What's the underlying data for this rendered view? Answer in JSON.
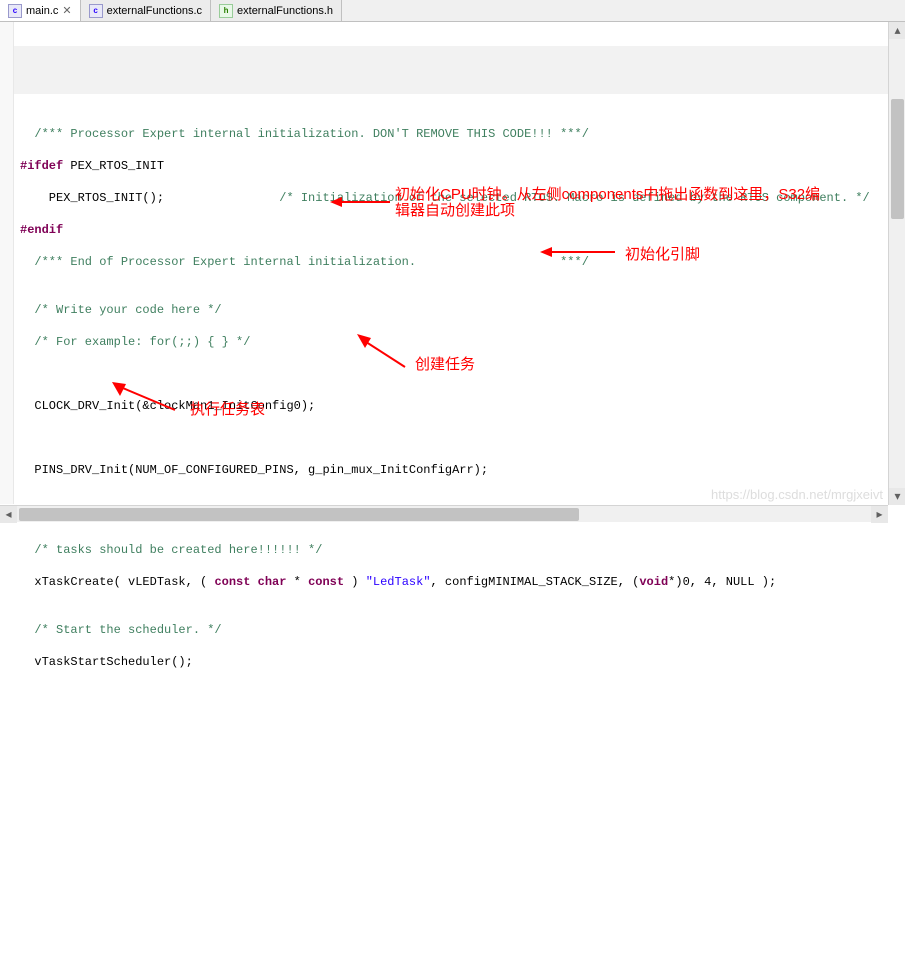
{
  "tabs": [
    {
      "icon": ".c",
      "label": "main.c",
      "active": true,
      "closable": true
    },
    {
      "icon": ".c",
      "label": "externalFunctions.c",
      "active": false,
      "closable": false
    },
    {
      "icon": ".h",
      "label": "externalFunctions.h",
      "active": false,
      "closable": false
    }
  ],
  "code": {
    "l1": "  /*** Processor Expert internal initialization. DON'T REMOVE THIS CODE!!! ***/",
    "l2a": "#ifdef",
    "l2b": " PEX_RTOS_INIT",
    "l3a": "    PEX_RTOS_INIT();                ",
    "l3b": "/* Initialization of the selected RTOS. Macro is defined by the RTOS component. */",
    "l4": "#endif",
    "l5": "  /*** End of Processor Expert internal initialization.                    ***/",
    "l6": "",
    "l7": "  /* Write your code here */",
    "l8": "  /* For example: for(;;) { } */",
    "l9": "",
    "l10": "",
    "l11": "  CLOCK_DRV_Init(&clockMan1_InitConfig0);",
    "l12": "",
    "l13": "",
    "l14": "  PINS_DRV_Init(NUM_OF_CONFIGURED_PINS, g_pin_mux_InitConfigArr);",
    "l15": "",
    "l16": "",
    "l17": "",
    "l18": "  /* tasks should be created here!!!!!! */",
    "l19a": "  xTaskCreate( vLEDTask, ( ",
    "l19b": "const",
    "l19c": " ",
    "l19d": "char",
    "l19e": " * ",
    "l19f": "const",
    "l19g": " ) ",
    "l19h": "\"LedTask\"",
    "l19i": ", configMINIMAL_STACK_SIZE, (",
    "l19j": "void",
    "l19k": "*)0, 4, NULL );",
    "l20": "",
    "l21": "  /* Start the scheduler. */",
    "l22": "  vTaskStartScheduler();",
    "l23": ""
  },
  "annotations": {
    "a1": "初始化CPU时钟。从左侧components中拖出函数到这里，S32编辑器自动创建此项",
    "a2": "初始化引脚",
    "a3": "创建任务",
    "a4": "执行任务表"
  },
  "watermark": "https://blog.csdn.net/mrgjxeivt"
}
